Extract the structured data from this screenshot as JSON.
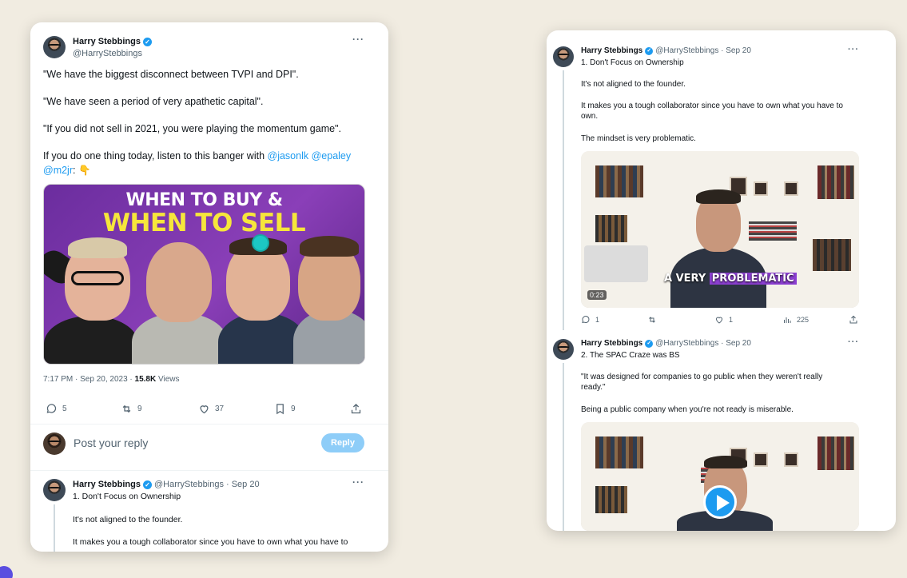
{
  "left_tweet": {
    "author": "Harry Stebbings",
    "handle": "@HarryStebbings",
    "lines": [
      "\"We have the biggest disconnect between TVPI and DPI\".",
      "\"We have seen a period of very apathetic capital\".",
      "\"If you did not sell in 2021, you were playing the momentum game\".",
      "If you do one thing today, listen to this banger with",
      ":"
    ],
    "mention_1": "@jasonlk",
    "mention_2": "@epaley",
    "mention_3": "@m2jr",
    "emoji": "👇",
    "thumbnail": {
      "title_line_1": "WHEN TO BUY &",
      "title_line_2": "WHEN TO SELL"
    },
    "timestamp": "7:17 PM · Sep 20, 2023 · ",
    "views_count": "15.8K",
    "views_label": " Views",
    "actions": {
      "replies": "5",
      "reposts": "9",
      "likes": "37",
      "bookmarks": "9"
    },
    "reply_placeholder": "Post your reply",
    "reply_button": "Reply",
    "thread_reply": {
      "author": "Harry Stebbings",
      "handle_date": "@HarryStebbings · Sep 20",
      "title": "1. Don't Focus on Ownership",
      "line_1": "It's not aligned to the founder.",
      "line_2": "It makes you a tough collaborator since you have to own what you have to"
    }
  },
  "right_thread": {
    "tweet_1": {
      "author": "Harry Stebbings",
      "handle_date": "@HarryStebbings · Sep 20",
      "title": "1. Don't Focus on Ownership",
      "line_1": "It's not aligned to the founder.",
      "line_2a": "It makes you a tough collaborator since you have to own what you have to",
      "line_2b": "own.",
      "line_3": "The mindset is very problematic.",
      "video_caption_1": "A VERY ",
      "video_caption_2": "PROBLEMATIC",
      "video_time": "0:23",
      "actions": {
        "replies": "1",
        "reposts": "",
        "likes": "1",
        "views": "225"
      }
    },
    "tweet_2": {
      "author": "Harry Stebbings",
      "handle_date": "@HarryStebbings · Sep 20",
      "title": "2. The SPAC Craze was BS",
      "line_1a": "\"It was designed for companies to go public when they weren't really",
      "line_1b": "ready.\"",
      "line_2": "Being a public company when you're not ready is miserable."
    }
  },
  "colors": {
    "accent": "#1d9bf0",
    "background": "#f1ece1",
    "thumbnail_purple": "#7a36aa",
    "caption_highlight": "#8b3fd0"
  }
}
